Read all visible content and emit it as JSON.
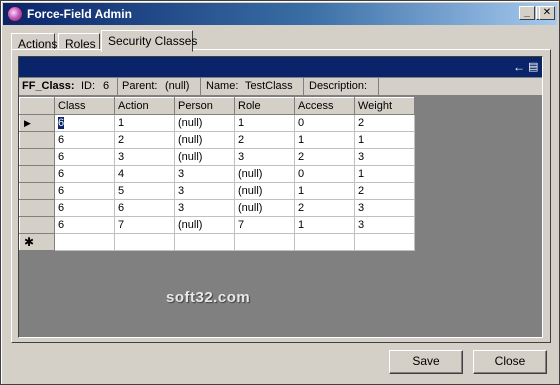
{
  "window": {
    "title": "Force-Field Admin"
  },
  "titlebar": {
    "minimize": "_",
    "maximize": "□",
    "close": "✕"
  },
  "tabs": [
    {
      "label": "Actions"
    },
    {
      "label": "Roles"
    },
    {
      "label": "Security Classes"
    }
  ],
  "toolbar": {
    "back_icon": "back-arrow-icon",
    "menu_icon": "dropdown-menu-icon"
  },
  "info": {
    "class_label": "FF_Class:",
    "id_label": "ID:",
    "id_value": "6",
    "parent_label": "Parent:",
    "parent_value": "(null)",
    "name_label": "Name:",
    "name_value": "TestClass",
    "description_label": "Description:",
    "description_value": ""
  },
  "grid": {
    "columns": [
      "Class",
      "Action",
      "Person",
      "Role",
      "Access",
      "Weight"
    ],
    "rows": [
      [
        "6",
        "1",
        "(null)",
        "1",
        "0",
        "2"
      ],
      [
        "6",
        "2",
        "(null)",
        "2",
        "1",
        "1"
      ],
      [
        "6",
        "3",
        "(null)",
        "3",
        "2",
        "3"
      ],
      [
        "6",
        "4",
        "3",
        "(null)",
        "0",
        "1"
      ],
      [
        "6",
        "5",
        "3",
        "(null)",
        "1",
        "2"
      ],
      [
        "6",
        "6",
        "3",
        "(null)",
        "2",
        "3"
      ],
      [
        "6",
        "7",
        "(null)",
        "7",
        "1",
        "3"
      ]
    ],
    "current_row_marker": "▶",
    "new_row_marker": "✱"
  },
  "watermark": "soft32.com",
  "buttons": {
    "save": "Save",
    "close": "Close"
  }
}
